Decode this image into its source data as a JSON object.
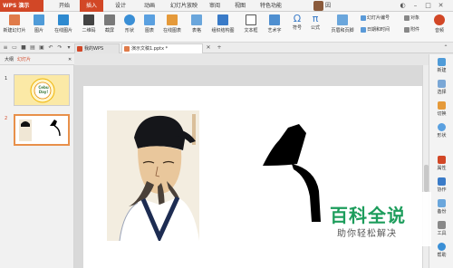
{
  "titlebar": {
    "app_name": "WPS 演示",
    "tabs": [
      "开始",
      "插入",
      "设计",
      "动画",
      "幻灯片放映",
      "审阅",
      "视图",
      "特色功能"
    ],
    "active_tab": "插入",
    "user_name": "因学钢笔官"
  },
  "ribbon": {
    "new_slide": "新建幻灯片",
    "picture": "图片",
    "online_picture": "在线图片",
    "qrcode": "二维码",
    "screenshot": "截屏",
    "shapes": "形状",
    "chart": "图表",
    "online_chart": "在线图表",
    "table": "表格",
    "org_chart": "组织结构图",
    "textbox": "文本框",
    "wordart": "艺术字",
    "symbol": "符号",
    "formula": "公式",
    "header_footer": "页眉和页脚",
    "slide_number": "幻灯片编号",
    "date_time": "日期和时间",
    "object": "对象",
    "attachment": "附件",
    "audio": "音频"
  },
  "tabs": {
    "my_wps": "我的WPS",
    "document": "演示文稿1.pptx *"
  },
  "panel": {
    "outline": "大纲",
    "slides": "幻灯片",
    "thumb1_text": "Cebu\nDay!"
  },
  "slide_numbers": [
    "1",
    "2"
  ],
  "right_sidebar": [
    "新建",
    "选择",
    "切换",
    "形状",
    "属性",
    "协作",
    "备份",
    "工具",
    "帮助"
  ],
  "watermark": {
    "title": "百科全说",
    "subtitle": "助你轻松解决"
  },
  "colors": {
    "accent": "#d24726",
    "watermark_green": "#1d9d5c"
  }
}
